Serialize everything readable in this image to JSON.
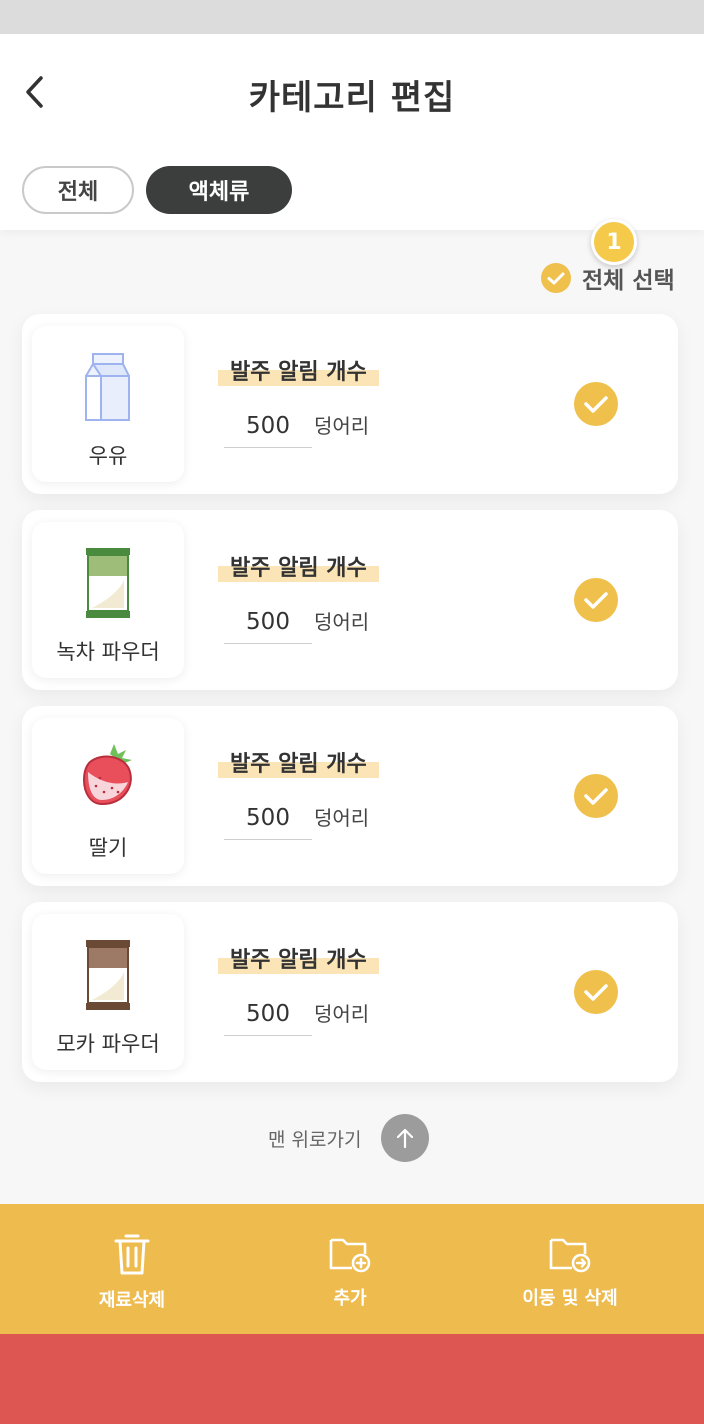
{
  "header": {
    "title": "카테고리 편집",
    "back_icon": "chevron-left-icon"
  },
  "filters": [
    {
      "label": "전체",
      "selected": false
    },
    {
      "label": "액체류",
      "selected": true
    }
  ],
  "selection": {
    "badge_count": "1",
    "select_all_label": "전체 선택",
    "select_all_checked": true
  },
  "items": [
    {
      "name": "우유",
      "icon": "milk-carton-icon",
      "alert_label": "발주 알림 개수",
      "quantity": "500",
      "unit": "덩어리",
      "checked": true
    },
    {
      "name": "녹차 파우더",
      "icon": "green-tea-powder-bag-icon",
      "alert_label": "발주 알림 개수",
      "quantity": "500",
      "unit": "덩어리",
      "checked": true
    },
    {
      "name": "딸기",
      "icon": "strawberry-icon",
      "alert_label": "발주 알림 개수",
      "quantity": "500",
      "unit": "덩어리",
      "checked": true
    },
    {
      "name": "모카 파우더",
      "icon": "mocha-powder-bag-icon",
      "alert_label": "발주 알림 개수",
      "quantity": "500",
      "unit": "덩어리",
      "checked": true
    }
  ],
  "scroll_top": {
    "label": "맨 위로가기",
    "icon": "arrow-up-icon"
  },
  "bottom_actions": [
    {
      "label": "재료삭제",
      "icon": "trash-icon"
    },
    {
      "label": "추가",
      "icon": "folder-add-icon"
    },
    {
      "label": "이동 및 삭제",
      "icon": "folder-move-icon"
    }
  ],
  "colors": {
    "accent": "#f0c04d",
    "bottom_bar": "#eebb4e",
    "dark_chip": "#3b3e3c",
    "highlight": "#fbe5b6",
    "footer_red": "#de5651"
  }
}
